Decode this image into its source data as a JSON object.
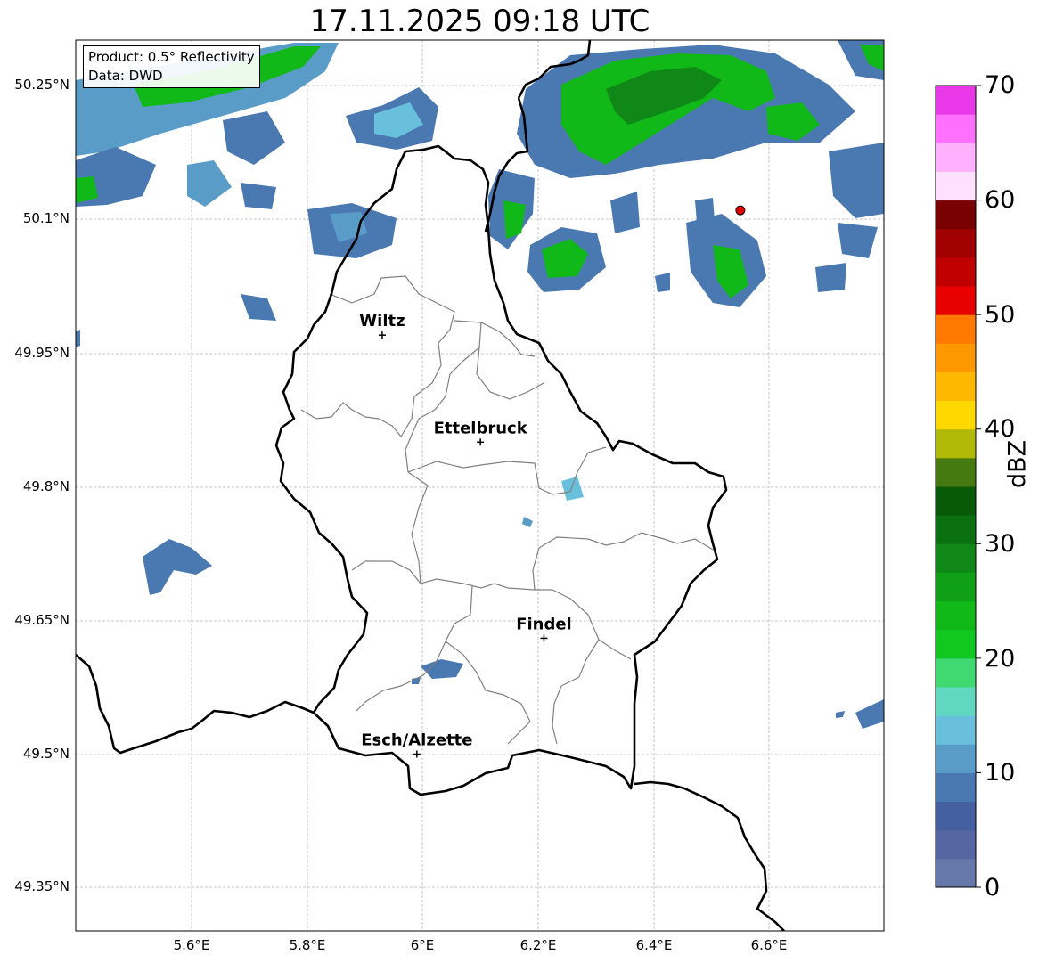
{
  "title": "17.11.2025 09:18 UTC",
  "product_box": {
    "line1": "Product: 0.5° Reflectivity",
    "line2": "Data: DWD"
  },
  "axes": {
    "lat_labels": [
      "50.25°N",
      "50.1°N",
      "49.95°N",
      "49.8°N",
      "49.65°N",
      "49.5°N",
      "49.35°N"
    ],
    "lon_labels": [
      "5.6°E",
      "5.8°E",
      "6°E",
      "6.2°E",
      "6.4°E",
      "6.6°E"
    ]
  },
  "cities": [
    {
      "name": "Wiltz",
      "lon": 5.93,
      "lat": 49.97
    },
    {
      "name": "Ettelbruck",
      "lon": 6.1,
      "lat": 49.85
    },
    {
      "name": "Findel",
      "lon": 6.21,
      "lat": 49.63
    },
    {
      "name": "Esch/Alzette",
      "lon": 5.99,
      "lat": 49.5
    }
  ],
  "radar_site": {
    "lon": 6.55,
    "lat": 50.11,
    "color": "#e00000"
  },
  "colorbar": {
    "label": "dBZ",
    "ticks": [
      "0",
      "10",
      "20",
      "30",
      "40",
      "50",
      "60",
      "70"
    ],
    "min": 0,
    "max": 70,
    "step": 2.5,
    "colors": [
      "#6677aa",
      "#5566a3",
      "#4460a0",
      "#4a78b0",
      "#5a9cc8",
      "#68c0dc",
      "#60d8c0",
      "#40d870",
      "#10c820",
      "#10b818",
      "#10a018",
      "#108818",
      "#0a7010",
      "#085a08",
      "#447a10",
      "#b0b808",
      "#ffd800",
      "#ffb800",
      "#ff9800",
      "#ff7800",
      "#e80000",
      "#c00000",
      "#a00000",
      "#780000",
      "#ffe0ff",
      "#ffb0ff",
      "#ff70ff",
      "#e838e8"
    ]
  }
}
